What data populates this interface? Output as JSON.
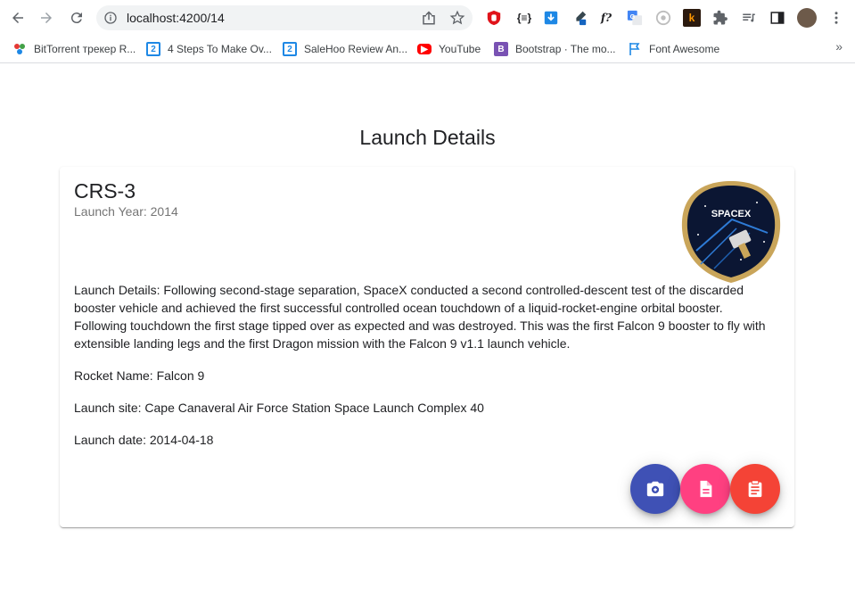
{
  "browser": {
    "url": "localhost:4200/14",
    "bookmarks": [
      {
        "label": "BitTorrent трекер R...",
        "icon": "torrent-icon"
      },
      {
        "label": "4 Steps To Make Ov...",
        "icon": "two-icon"
      },
      {
        "label": "SaleHoo Review An...",
        "icon": "two-icon"
      },
      {
        "label": "YouTube",
        "icon": "youtube-icon"
      },
      {
        "label": "Bootstrap · The mo...",
        "icon": "bootstrap-icon"
      },
      {
        "label": "Font Awesome",
        "icon": "flag-icon"
      }
    ],
    "bookmarks_more": "»"
  },
  "page": {
    "title": "Launch Details"
  },
  "launch": {
    "mission_name": "CRS-3",
    "launch_year": "Launch Year: 2014",
    "details": "Launch Details: Following second-stage separation, SpaceX conducted a second controlled-descent test of the discarded booster vehicle and achieved the first successful controlled ocean touchdown of a liquid-rocket-engine orbital booster. Following touchdown the first stage tipped over as expected and was destroyed. This was the first Falcon 9 booster to fly with extensible landing legs and the first Dragon mission with the Falcon 9 v1.1 launch vehicle.",
    "rocket_name": "Rocket Name: Falcon 9",
    "launch_site": "Launch site: Cape Canaveral Air Force Station Space Launch Complex 40",
    "launch_date": "Launch date: 2014-04-18",
    "patch_text": "SPACEX"
  },
  "colors": {
    "fab_camera": "#3f51b5",
    "fab_article": "#ff4081",
    "fab_assignment": "#f44336"
  }
}
